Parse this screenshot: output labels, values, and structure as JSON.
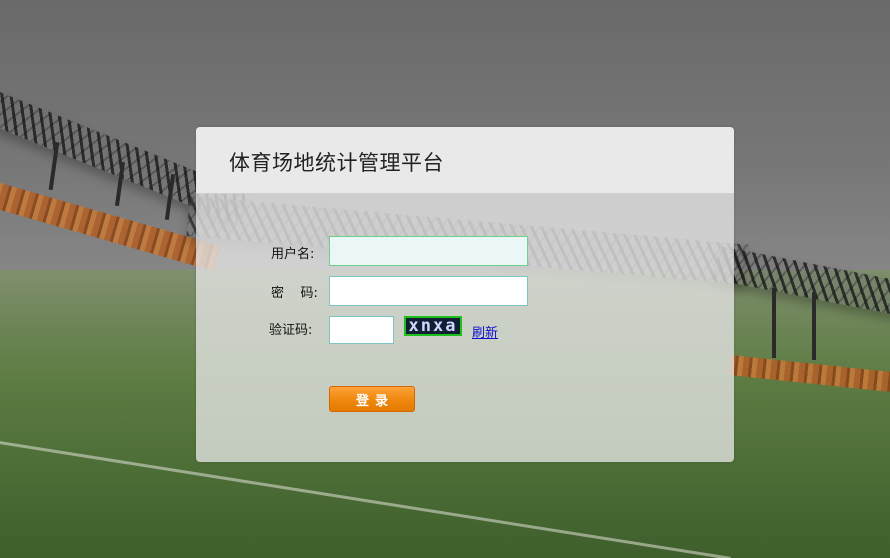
{
  "app": {
    "title": "体育场地统计管理平台"
  },
  "login_form": {
    "username_label": "用户名:",
    "username_value": "",
    "password_label": "密    码:",
    "password_value": "",
    "captcha_label": "验证码:",
    "captcha_value": "",
    "captcha_image_text": "xnxa",
    "refresh_link": "刷新",
    "submit_label": "登录"
  },
  "colors": {
    "button_orange": "#f08a10",
    "captcha_border": "#1ec01e",
    "link_blue": "#1010cc"
  },
  "background": {
    "scene": "stadium-canopy-and-grass-field"
  }
}
